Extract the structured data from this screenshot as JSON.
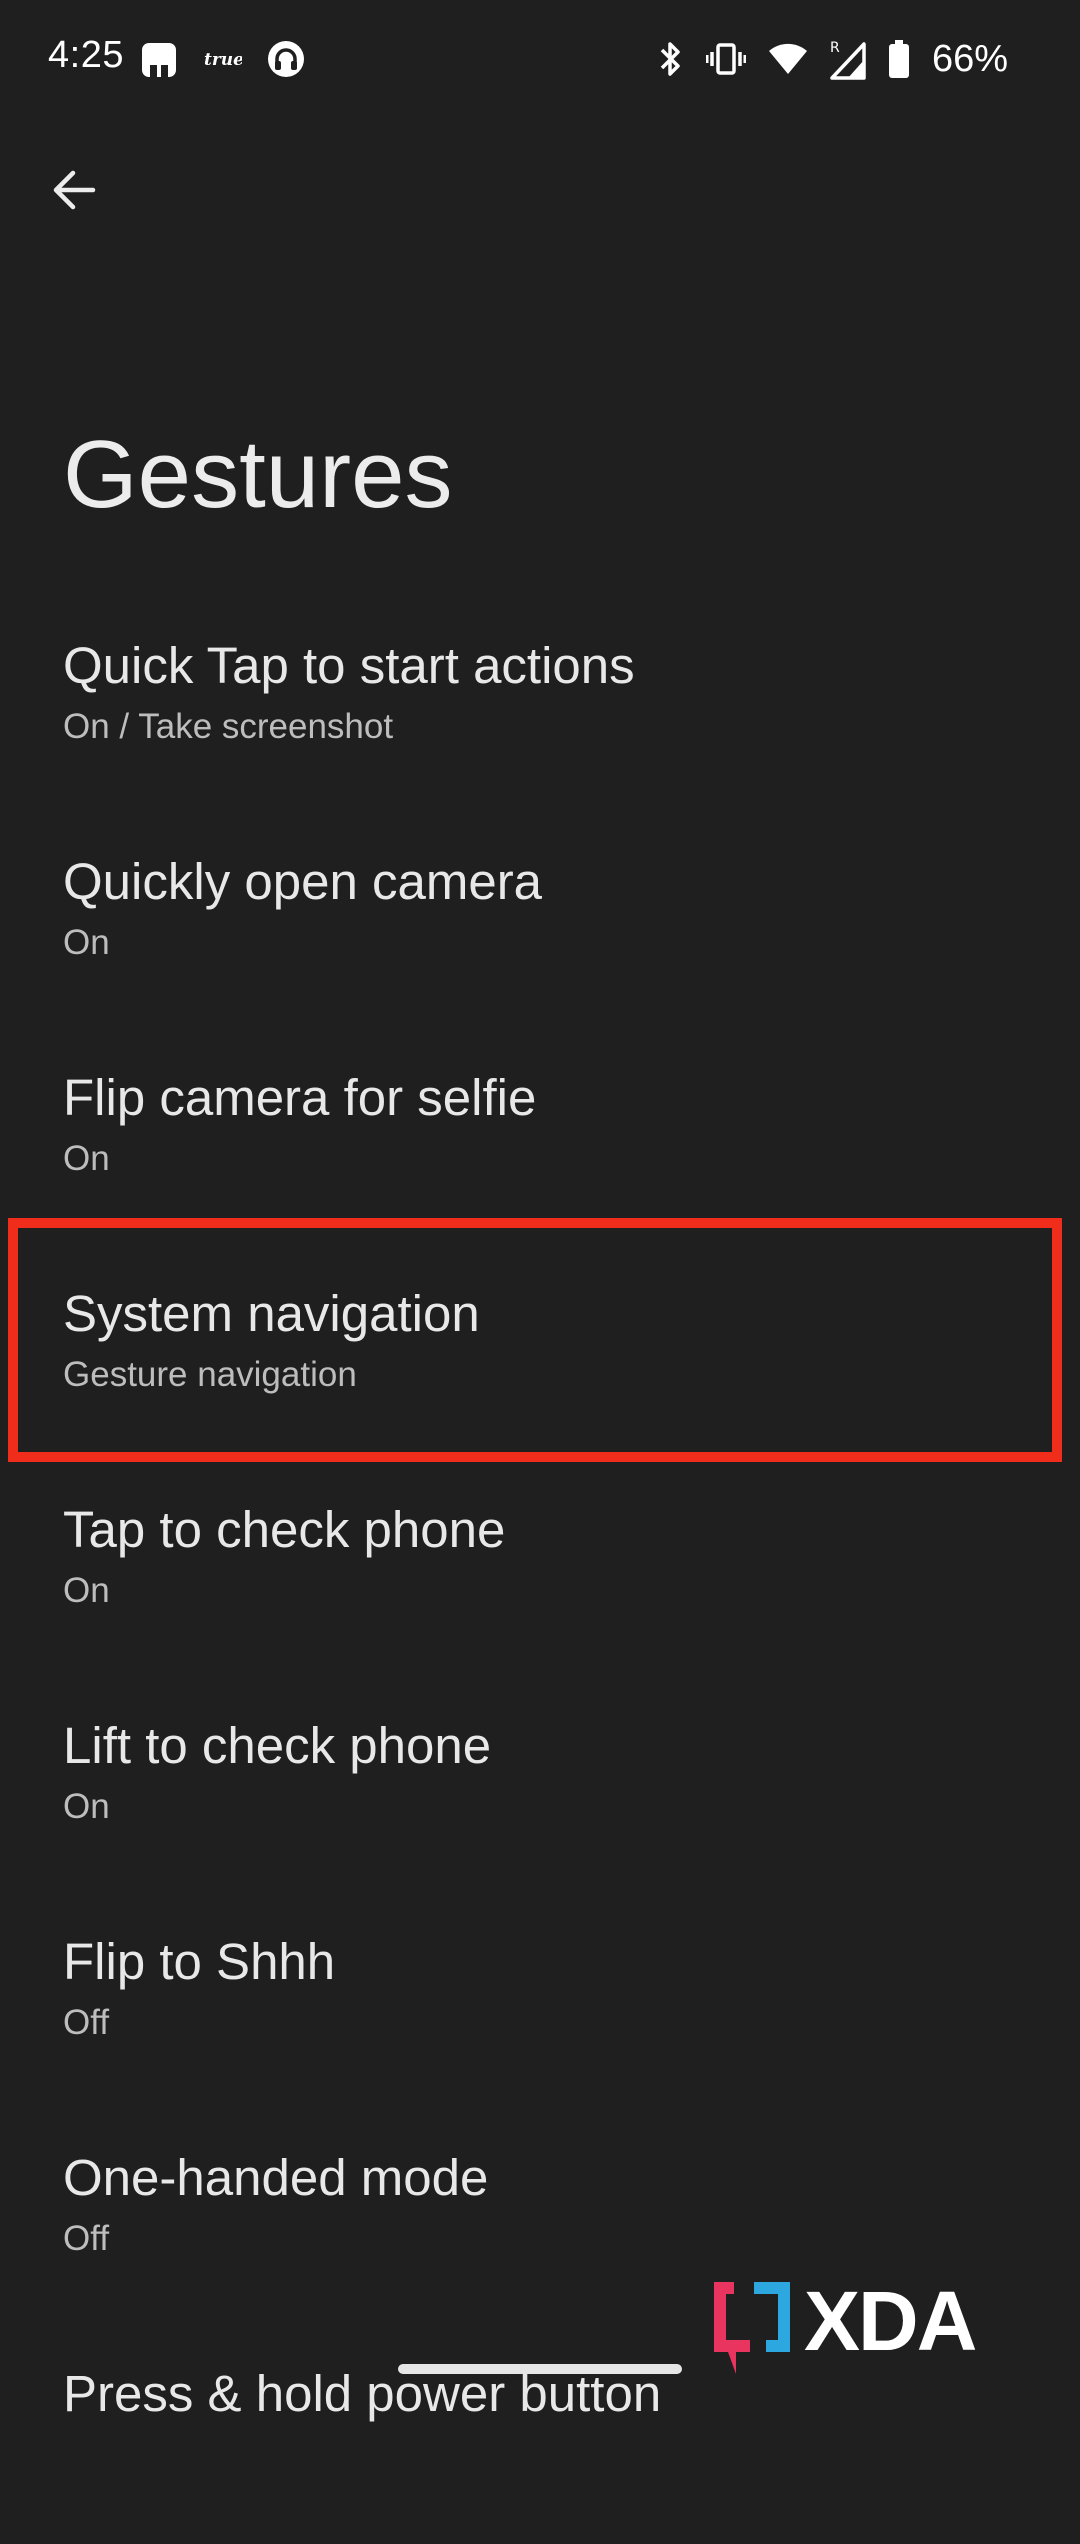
{
  "status_bar": {
    "time": "4:25",
    "battery_percent": "66%",
    "left_icons": [
      "app-notification-icon",
      "true-app-icon",
      "headset-icon"
    ],
    "true_label": "true",
    "right_icons": [
      "bluetooth-icon",
      "vibrate-icon",
      "wifi-icon",
      "signal-roaming-icon",
      "battery-icon"
    ],
    "roaming_indicator": "R"
  },
  "header": {
    "back_icon": "arrow-back-icon",
    "title": "Gestures"
  },
  "settings": [
    {
      "title": "Quick Tap to start actions",
      "summary": "On / Take screenshot"
    },
    {
      "title": "Quickly open camera",
      "summary": "On"
    },
    {
      "title": "Flip camera for selfie",
      "summary": "On"
    },
    {
      "title": "System navigation",
      "summary": "Gesture navigation",
      "highlighted": true
    },
    {
      "title": "Tap to check phone",
      "summary": "On"
    },
    {
      "title": "Lift to check phone",
      "summary": "On"
    },
    {
      "title": "Flip to Shhh",
      "summary": "Off"
    },
    {
      "title": "One-handed mode",
      "summary": "Off"
    },
    {
      "title": "Press & hold power button",
      "summary": ""
    }
  ],
  "watermark": {
    "text": "XDA"
  },
  "colors": {
    "background": "#1f1f1f",
    "highlight": "#f02d1a",
    "xda_pink": "#e8345e",
    "xda_blue": "#2da7df"
  }
}
